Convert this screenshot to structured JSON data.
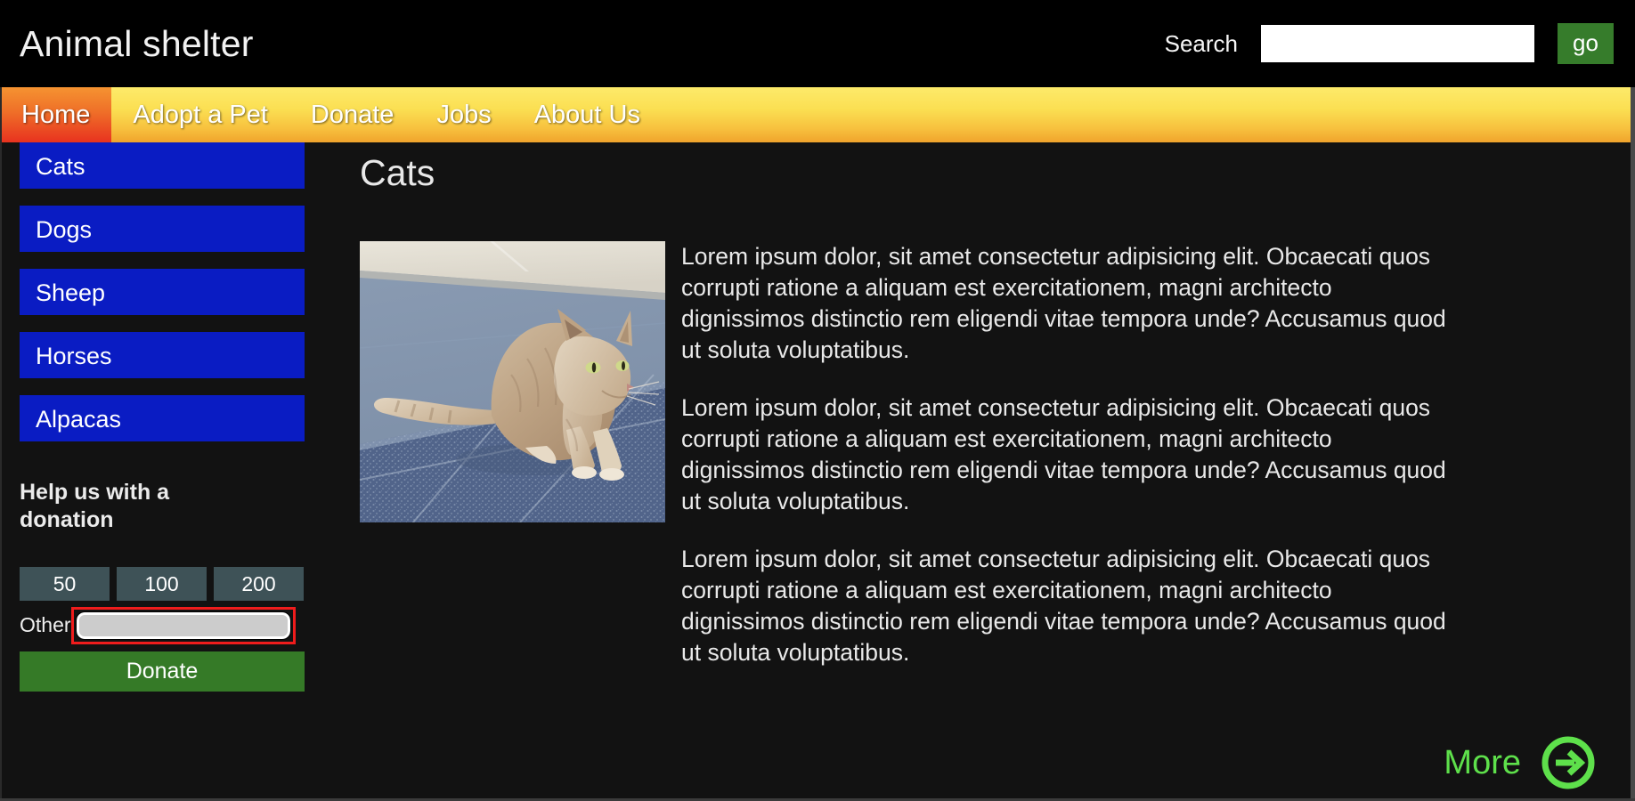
{
  "header": {
    "site_title": "Animal shelter",
    "search_label": "Search",
    "search_value": "",
    "search_placeholder": "",
    "go_label": "go",
    "go_color": "#367c2b"
  },
  "nav": {
    "items": [
      {
        "label": "Home",
        "active": true
      },
      {
        "label": "Adopt a Pet",
        "active": false
      },
      {
        "label": "Donate",
        "active": false
      },
      {
        "label": "Jobs",
        "active": false
      },
      {
        "label": "About Us",
        "active": false
      }
    ],
    "active_bg": "#e8321f",
    "bar_gradient_top": "#fdea6a",
    "bar_gradient_bottom": "#f0a32c"
  },
  "sidebar": {
    "categories": [
      {
        "label": "Cats"
      },
      {
        "label": "Dogs"
      },
      {
        "label": "Sheep"
      },
      {
        "label": "Horses"
      },
      {
        "label": "Alpacas"
      }
    ],
    "category_color": "#0a1cc3",
    "donation": {
      "heading": "Help us with a donation",
      "amounts": [
        "50",
        "100",
        "200"
      ],
      "amount_color": "#3e5257",
      "other_label": "Other",
      "other_value": "",
      "other_placeholder": "",
      "focus_outline_color": "#ef1c1c",
      "donate_label": "Donate",
      "donate_color": "#357a27"
    }
  },
  "main": {
    "page_title": "Cats",
    "photo_alt": "cat-photo",
    "paragraphs": [
      "Lorem ipsum dolor, sit amet consectetur adipisicing elit. Obcaecati quos corrupti ratione a aliquam est exercitationem, magni architecto dignissimos distinctio rem eligendi vitae tempora unde? Accusamus quod ut soluta voluptatibus.",
      "Lorem ipsum dolor, sit amet consectetur adipisicing elit. Obcaecati quos corrupti ratione a aliquam est exercitationem, magni architecto dignissimos distinctio rem eligendi vitae tempora unde? Accusamus quod ut soluta voluptatibus.",
      "Lorem ipsum dolor, sit amet consectetur adipisicing elit. Obcaecati quos corrupti ratione a aliquam est exercitationem, magni architecto dignissimos distinctio rem eligendi vitae tempora unde? Accusamus quod ut soluta voluptatibus."
    ],
    "more_label": "More",
    "more_icon": "arrow-right-circle-icon",
    "more_color": "#5ee04b"
  },
  "page": {
    "background": "#121212",
    "text_color": "#e9e9e9"
  }
}
